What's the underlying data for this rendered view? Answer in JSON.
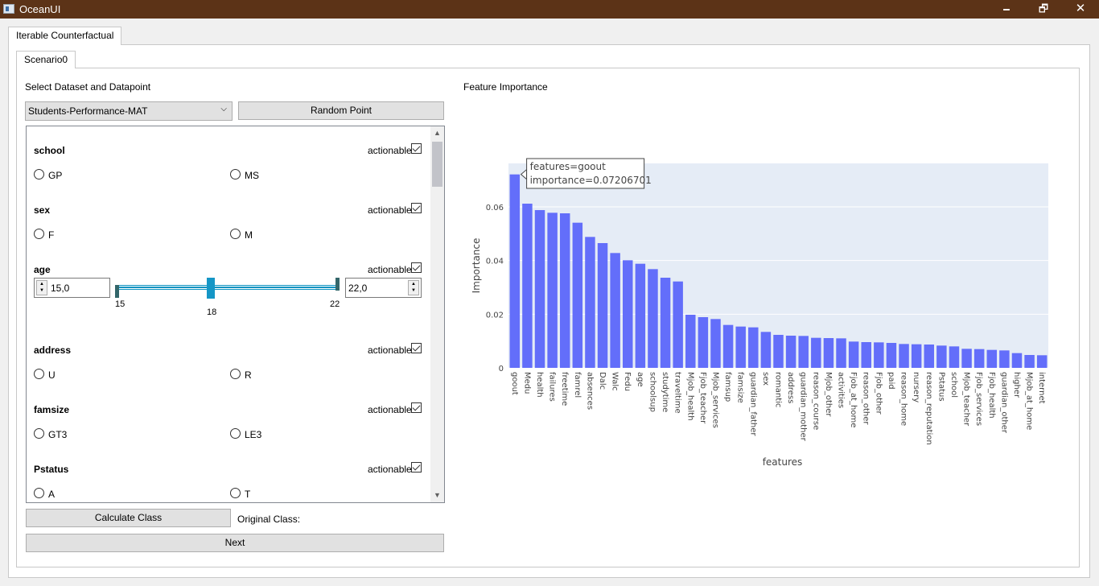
{
  "window": {
    "title": "OceanUI",
    "minimize": "🗕",
    "maximize": "🗗",
    "close": "✕"
  },
  "outer_tab": "Iterable Counterfactual",
  "inner_tab": "Scenario0",
  "left": {
    "section_label": "Select Dataset and Datapoint",
    "dataset": "Students-Performance-MAT",
    "random_point": "Random Point",
    "actionable_label": "actionable",
    "features": {
      "school": {
        "name": "school",
        "options": [
          "GP",
          "MS"
        ],
        "actionable": true
      },
      "sex": {
        "name": "sex",
        "options": [
          "F",
          "M"
        ],
        "actionable": true
      },
      "age": {
        "name": "age",
        "min_value": "15,0",
        "max_value": "22,0",
        "tick_min": "15",
        "tick_mid": "18",
        "tick_max": "22",
        "actionable": true
      },
      "address": {
        "name": "address",
        "options": [
          "U",
          "R"
        ],
        "actionable": true
      },
      "famsize": {
        "name": "famsize",
        "options": [
          "GT3",
          "LE3"
        ],
        "actionable": true
      },
      "pstatus": {
        "name": "Pstatus",
        "options": [
          "A",
          "T"
        ],
        "actionable": true
      }
    },
    "calculate_class": "Calculate Class",
    "original_class_label": "Original Class:",
    "next": "Next"
  },
  "right": {
    "section_label": "Feature Importance"
  },
  "tooltip": {
    "line1": "features=goout",
    "line2": "importance=0.07206701"
  },
  "chart_data": {
    "type": "bar",
    "xlabel": "features",
    "ylabel": "Importance",
    "ylim": [
      0,
      0.0762
    ],
    "yticks": [
      "0",
      "0.02",
      "0.04",
      "0.06"
    ],
    "bar_color": "#636efa",
    "plot_bg": "#e5ecf6",
    "grid": true,
    "categories": [
      "goout",
      "Medu",
      "health",
      "failures",
      "freetime",
      "famrel",
      "absences",
      "Dalc",
      "Walc",
      "Fedu",
      "age",
      "schoolsup",
      "studytime",
      "traveltime",
      "Mjob_health",
      "Fjob_teacher",
      "Mjob_services",
      "famsup",
      "famsize",
      "guardian_father",
      "sex",
      "romantic",
      "address",
      "guardian_mother",
      "reason_course",
      "Mjob_other",
      "activities",
      "Fjob_at_home",
      "reason_other",
      "Fjob_other",
      "paid",
      "reason_home",
      "nursery",
      "reason_reputation",
      "Pstatus",
      "school",
      "Mjob_teacher",
      "Fjob_services",
      "Fjob_health",
      "guardian_other",
      "higher",
      "Mjob_at_home",
      "internet"
    ],
    "values": [
      0.0721,
      0.0612,
      0.0588,
      0.0578,
      0.0576,
      0.0541,
      0.0488,
      0.0465,
      0.0428,
      0.0401,
      0.0388,
      0.0368,
      0.0336,
      0.0322,
      0.0198,
      0.0189,
      0.0182,
      0.016,
      0.0154,
      0.0151,
      0.0134,
      0.0123,
      0.012,
      0.0119,
      0.0112,
      0.0111,
      0.011,
      0.0098,
      0.0096,
      0.0095,
      0.0093,
      0.0089,
      0.0088,
      0.0087,
      0.0083,
      0.008,
      0.0071,
      0.007,
      0.0067,
      0.0065,
      0.0055,
      0.0048,
      0.0047
    ]
  }
}
